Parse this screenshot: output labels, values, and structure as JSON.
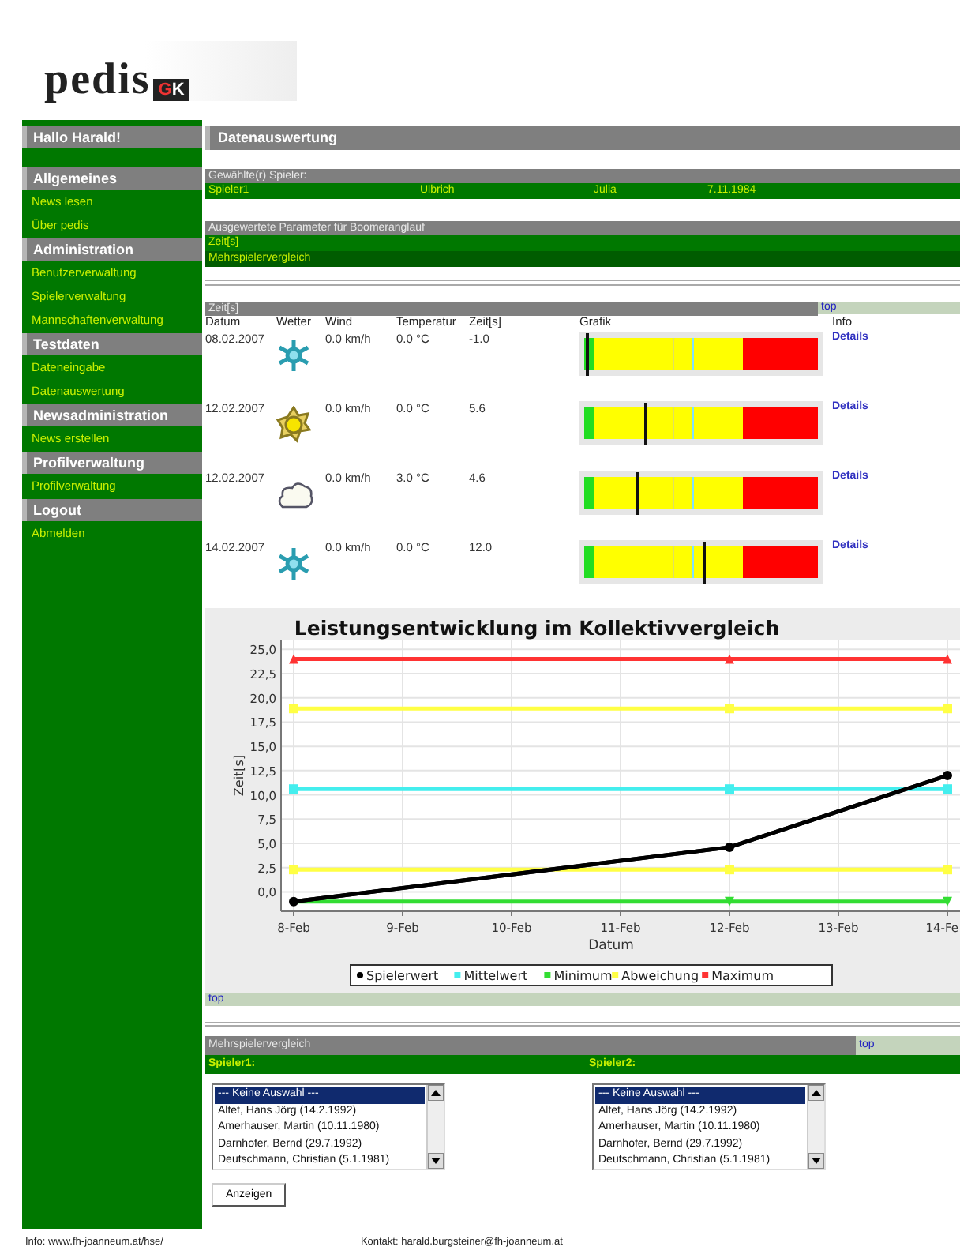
{
  "logo": {
    "name": "pedis",
    "badge": "GK"
  },
  "sidebar": {
    "greeting": "Hallo Harald!",
    "sections": [
      {
        "title": "Allgemeines",
        "items": [
          "News lesen",
          "Über pedis"
        ]
      },
      {
        "title": "Administration",
        "items": [
          "Benutzerverwaltung",
          "Spielerverwaltung",
          "Mannschaftenverwaltung"
        ]
      },
      {
        "title": "Testdaten",
        "items": [
          "Dateneingabe",
          "Datenauswertung"
        ]
      },
      {
        "title": "Newsadministration",
        "items": [
          "News erstellen"
        ]
      },
      {
        "title": "Profilverwaltung",
        "items": [
          "Profilverwaltung"
        ]
      },
      {
        "title": "Logout",
        "items": [
          "Abmelden"
        ]
      }
    ]
  },
  "page_title": "Datenauswertung",
  "player": {
    "heading": "Gewählte(r) Spieler:",
    "cells": [
      "Spieler1",
      "Ulbrich",
      "Julia",
      "7.11.1984"
    ]
  },
  "parameters": {
    "heading": "Ausgewertete Parameter für Boomeranglauf",
    "items": [
      "Zeit[s]",
      "Mehrspielervergleich"
    ]
  },
  "results": {
    "heading": "Zeit[s]",
    "top_link": "top",
    "columns": [
      "Datum",
      "Wetter",
      "Wind",
      "Temperatur",
      "Zeit[s]",
      "Grafik",
      "Info"
    ],
    "rows": [
      {
        "date": "08.02.2007",
        "weather": {
          "kind": "snow"
        },
        "wind": "0.0 km/h",
        "temperature": "0.0 °C",
        "time": "-1.0",
        "level": 0.01,
        "info": "Details"
      },
      {
        "date": "12.02.2007",
        "weather": {
          "kind": "sun"
        },
        "wind": "0.0 km/h",
        "temperature": "0.0 °C",
        "time": "5.6",
        "level": 0.26,
        "info": "Details"
      },
      {
        "date": "12.02.2007",
        "weather": {
          "kind": "cloud"
        },
        "wind": "0.0 km/h",
        "temperature": "3.0 °C",
        "time": "4.6",
        "level": 0.22,
        "info": "Details"
      },
      {
        "date": "14.02.2007",
        "weather": {
          "kind": "snow"
        },
        "wind": "0.0 km/h",
        "temperature": "0.0 °C",
        "time": "12.0",
        "level": 0.51,
        "info": "Details"
      }
    ]
  },
  "chart": {
    "top_link": "top",
    "chart_data": {
      "type": "line",
      "title": "Leistungsentwicklung im Kollektivvergleich",
      "xlabel": "Datum",
      "ylabel": "Zeit[s]",
      "categories": [
        "8-Feb",
        "9-Feb",
        "10-Feb",
        "11-Feb",
        "12-Feb",
        "13-Feb",
        "14-Fe"
      ],
      "ylim": [
        -2,
        26
      ],
      "grid": true,
      "legend": true,
      "yticks": [
        {
          "value": 0,
          "label": "0,0"
        },
        {
          "value": 2.5,
          "label": "2,5"
        },
        {
          "value": 5,
          "label": "5,0"
        },
        {
          "value": 7.5,
          "label": "7,5"
        },
        {
          "value": 10,
          "label": "10,0"
        },
        {
          "value": 12.5,
          "label": "12,5"
        },
        {
          "value": 15,
          "label": "15,0"
        },
        {
          "value": 17.5,
          "label": "17,5"
        },
        {
          "value": 20,
          "label": "20,0"
        },
        {
          "value": 22.5,
          "label": "22,5"
        },
        {
          "value": 25,
          "label": "25,0"
        }
      ],
      "series": [
        {
          "name": "Spielerwert",
          "color": "#000000",
          "marker": "circle",
          "values": [
            -1.0,
            null,
            null,
            null,
            4.6,
            null,
            12.0
          ]
        },
        {
          "name": "Mittelwert",
          "color": "#44eeee",
          "marker": "square",
          "values": [
            10.6,
            null,
            null,
            null,
            10.6,
            null,
            10.6
          ]
        },
        {
          "name": "Minimum",
          "color": "#33dd33",
          "marker": "triangle-down",
          "values": [
            -1.0,
            null,
            null,
            null,
            -1.0,
            null,
            -1.0
          ]
        },
        {
          "name": "Abweichung",
          "color": "#ffff44",
          "marker": "square",
          "values": [
            18.9,
            null,
            null,
            null,
            18.9,
            null,
            18.9
          ]
        },
        {
          "color": "#ffff44",
          "marker": "square",
          "values": [
            2.3,
            null,
            null,
            null,
            2.3,
            null,
            2.3
          ]
        },
        {
          "name": "Maximum",
          "color": "#ff3333",
          "marker": "triangle-up",
          "values": [
            24.0,
            null,
            null,
            null,
            24.0,
            null,
            24.0
          ]
        }
      ]
    }
  },
  "compare": {
    "heading": "Mehrspielervergleich",
    "top_link": "top",
    "lists": [
      {
        "label": "Spieler1:",
        "options": [
          {
            "text": "--- Keine Auswahl ---",
            "selected": true
          },
          {
            "text": "Altet, Hans Jörg (14.2.1992)",
            "selected": false
          },
          {
            "text": "Amerhauser, Martin (10.11.1980)",
            "selected": false
          },
          {
            "text": "Darnhofer, Bernd (29.7.1992)",
            "selected": false
          },
          {
            "text": "Deutschmann, Christian (5.1.1981)",
            "selected": false
          }
        ]
      },
      {
        "label": "Spieler2:",
        "options": [
          {
            "text": "--- Keine Auswahl ---",
            "selected": true
          },
          {
            "text": "Altet, Hans Jörg (14.2.1992)",
            "selected": false
          },
          {
            "text": "Amerhauser, Martin (10.11.1980)",
            "selected": false
          },
          {
            "text": "Darnhofer, Bernd (29.7.1992)",
            "selected": false
          },
          {
            "text": "Deutschmann, Christian (5.1.1981)",
            "selected": false
          }
        ]
      }
    ],
    "button": "Anzeigen"
  },
  "footer": {
    "info": "Info: www.fh-joanneum.at/hse/",
    "contact": "Kontakt: harald.burgsteiner@fh-joanneum.at"
  }
}
